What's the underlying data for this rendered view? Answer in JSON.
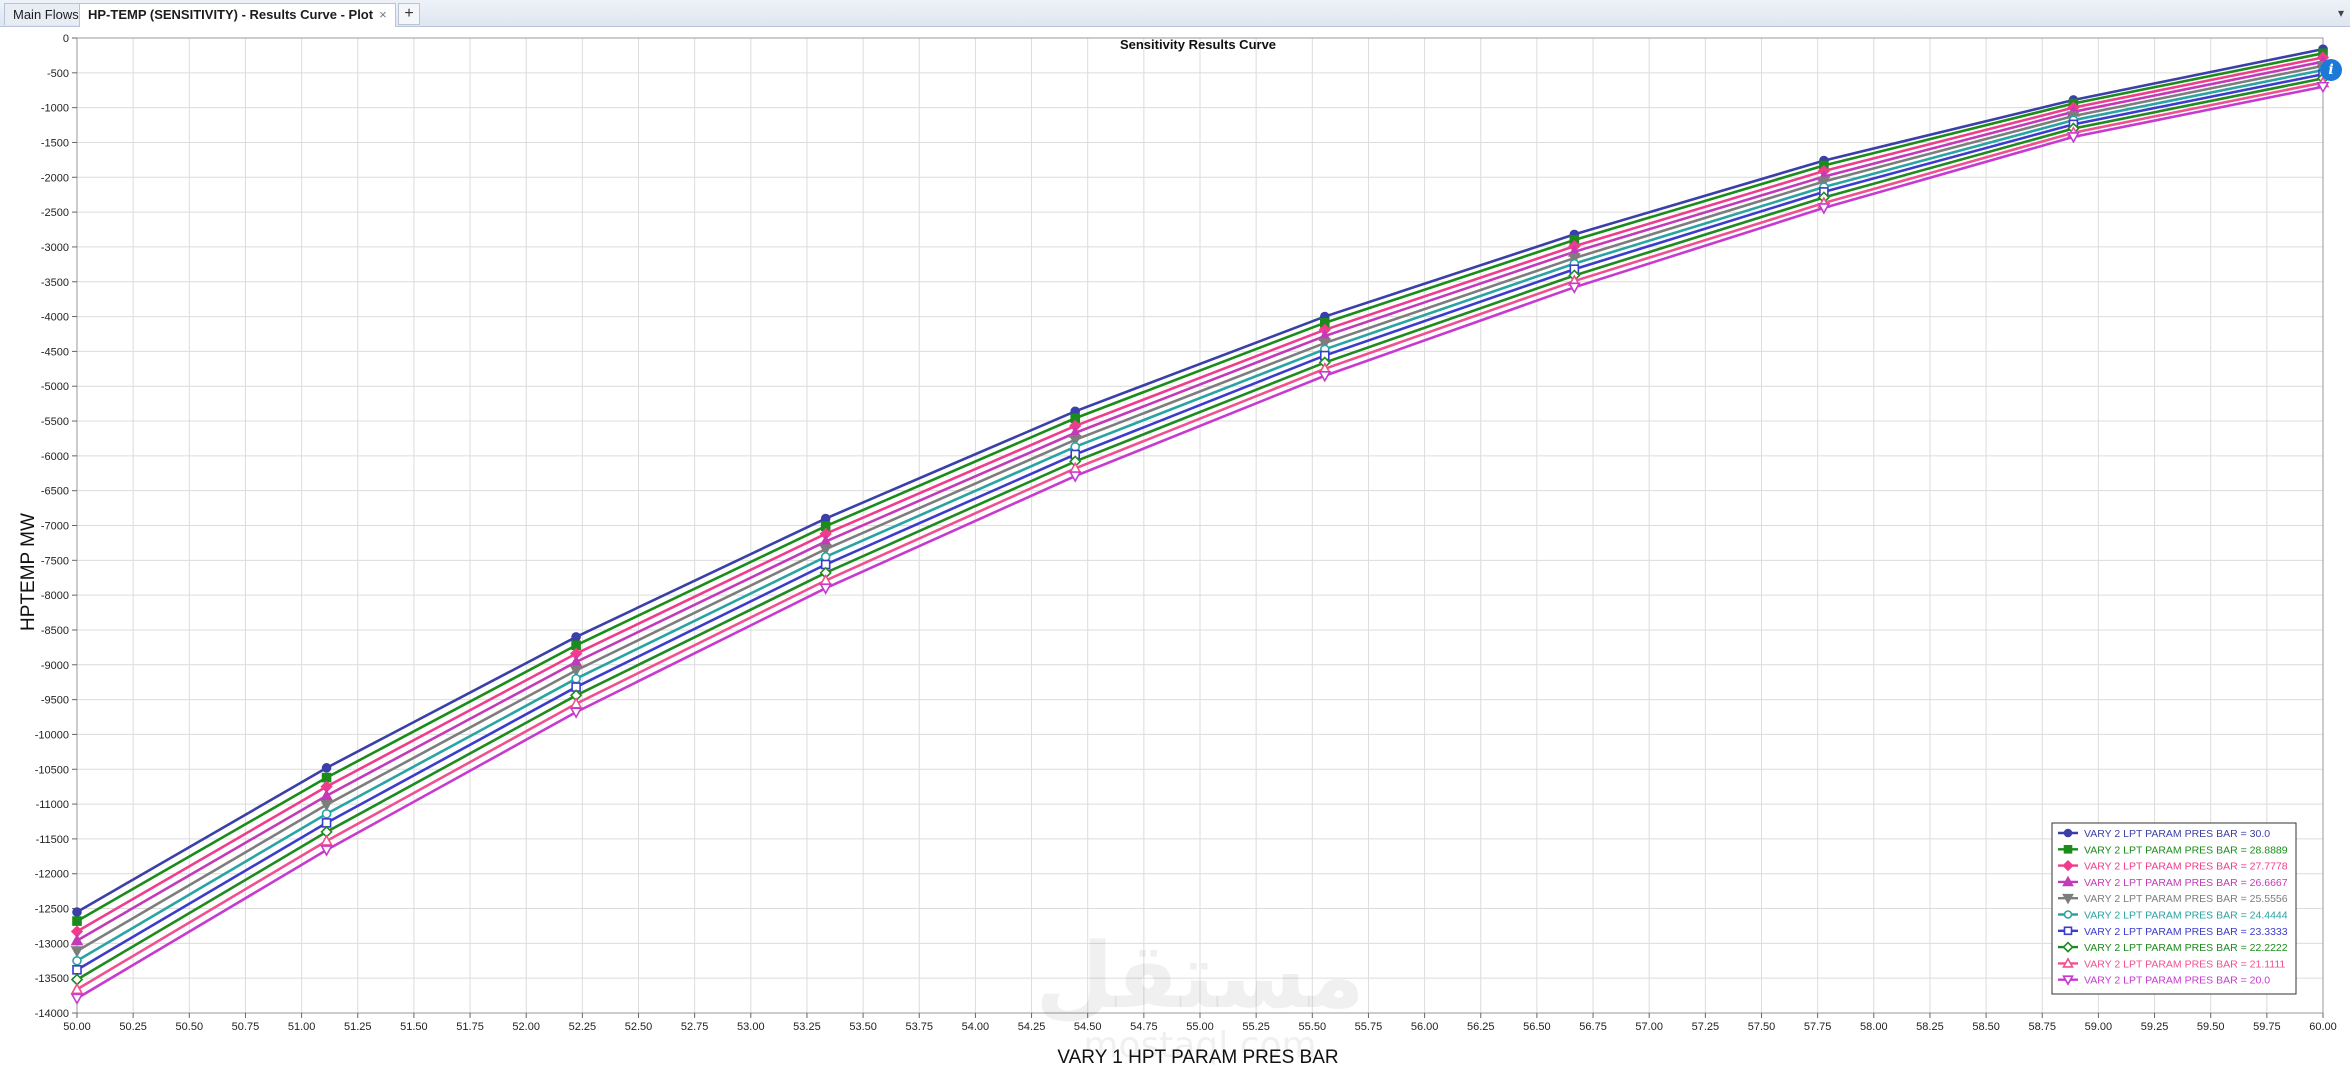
{
  "tabs": [
    {
      "label": "Main Flowsheet",
      "active": false
    },
    {
      "label": "HP-TEMP (SENSITIVITY) - Results Curve - Plot",
      "active": true
    }
  ],
  "new_tab_label": "+",
  "close_glyph": "×",
  "info_icon": "i",
  "watermark": {
    "arabic": "مستقل",
    "latin": "mostaql.com"
  },
  "chart_data": {
    "type": "line",
    "title": "Sensitivity Results Curve",
    "xlabel": "VARY    1 HPT PARAM PRES BAR",
    "ylabel": "HPTEMP MW",
    "xlim": [
      50.0,
      60.0
    ],
    "ylim": [
      -14000,
      0
    ],
    "grid": true,
    "legend_position": "bottom-right",
    "x_ticks": [
      "50.00",
      "50.25",
      "50.50",
      "50.75",
      "51.00",
      "51.25",
      "51.50",
      "51.75",
      "52.00",
      "52.25",
      "52.50",
      "52.75",
      "53.00",
      "53.25",
      "53.50",
      "53.75",
      "54.00",
      "54.25",
      "54.50",
      "54.75",
      "55.00",
      "55.25",
      "55.50",
      "55.75",
      "56.00",
      "56.25",
      "56.50",
      "56.75",
      "57.00",
      "57.25",
      "57.50",
      "57.75",
      "58.00",
      "58.25",
      "58.50",
      "58.75",
      "59.00",
      "59.25",
      "59.50",
      "59.75",
      "60.00"
    ],
    "y_ticks": [
      "0",
      "-500",
      "-1000",
      "-1500",
      "-2000",
      "-2500",
      "-3000",
      "-3500",
      "-4000",
      "-4500",
      "-5000",
      "-5500",
      "-6000",
      "-6500",
      "-7000",
      "-7500",
      "-8000",
      "-8500",
      "-9000",
      "-9500",
      "-10000",
      "-10500",
      "-11000",
      "-11500",
      "-12000",
      "-12500",
      "-13000",
      "-13500",
      "-14000"
    ],
    "x": [
      50.0,
      51.1111,
      52.2222,
      53.3333,
      54.4444,
      55.5556,
      56.6667,
      57.7778,
      58.8889,
      60.0
    ],
    "series": [
      {
        "name": "VARY   2 LPT PARAM PRES BAR =  30.0",
        "color": "#3b3fa8",
        "marker": "circle-filled",
        "values": [
          -12550,
          -10480,
          -8600,
          -6900,
          -5360,
          -4000,
          -2820,
          -1760,
          -890,
          -160
        ]
      },
      {
        "name": "VARY   2 LPT PARAM PRES BAR =  28.8889",
        "color": "#1a8c1a",
        "marker": "square-filled",
        "values": [
          -12680,
          -10620,
          -8720,
          -7010,
          -5460,
          -4090,
          -2900,
          -1830,
          -940,
          -220
        ]
      },
      {
        "name": "VARY   2 LPT PARAM PRES BAR =  27.7778",
        "color": "#f03c8c",
        "marker": "diamond-filled",
        "values": [
          -12830,
          -10750,
          -8840,
          -7120,
          -5570,
          -4190,
          -2990,
          -1910,
          -1000,
          -280
        ]
      },
      {
        "name": "VARY   2 LPT PARAM PRES BAR =  26.6667",
        "color": "#c23ab8",
        "marker": "triangle-up-filled",
        "values": [
          -12960,
          -10880,
          -8960,
          -7230,
          -5670,
          -4280,
          -3070,
          -1990,
          -1060,
          -340
        ]
      },
      {
        "name": "VARY   2 LPT PARAM PRES BAR =  25.5556",
        "color": "#7d7d7d",
        "marker": "triangle-down-filled",
        "values": [
          -13110,
          -11010,
          -9080,
          -7340,
          -5770,
          -4380,
          -3160,
          -2060,
          -1120,
          -400
        ]
      },
      {
        "name": "VARY   2 LPT PARAM PRES BAR =  24.4444",
        "color": "#2aa3a3",
        "marker": "circle-open",
        "values": [
          -13250,
          -11140,
          -9200,
          -7450,
          -5870,
          -4470,
          -3240,
          -2140,
          -1180,
          -460
        ]
      },
      {
        "name": "VARY   2 LPT PARAM PRES BAR =  23.3333",
        "color": "#3c3ccc",
        "marker": "square-open",
        "values": [
          -13380,
          -11270,
          -9320,
          -7560,
          -5980,
          -4560,
          -3320,
          -2210,
          -1240,
          -520
        ]
      },
      {
        "name": "VARY   2 LPT PARAM PRES BAR =  22.2222",
        "color": "#1f8a1f",
        "marker": "diamond-open",
        "values": [
          -13520,
          -11400,
          -9440,
          -7680,
          -6080,
          -4660,
          -3410,
          -2290,
          -1300,
          -580
        ]
      },
      {
        "name": "VARY   2 LPT PARAM PRES BAR =  21.1111",
        "color": "#f05090",
        "marker": "triangle-up-open",
        "values": [
          -13660,
          -11530,
          -9560,
          -7790,
          -6180,
          -4750,
          -3490,
          -2370,
          -1360,
          -640
        ]
      },
      {
        "name": "VARY   2 LPT PARAM PRES BAR =  20.0",
        "color": "#c63ad0",
        "marker": "triangle-down-open",
        "values": [
          -13790,
          -11660,
          -9680,
          -7900,
          -6290,
          -4850,
          -3580,
          -2440,
          -1420,
          -700
        ]
      }
    ]
  }
}
